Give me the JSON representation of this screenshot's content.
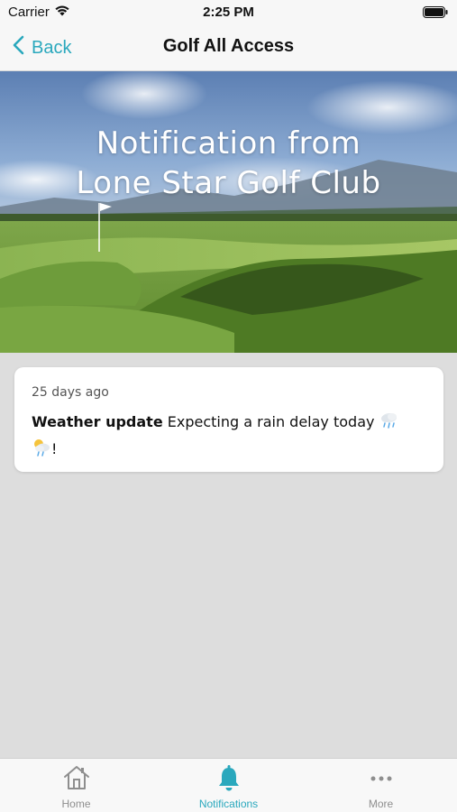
{
  "status_bar": {
    "carrier": "Carrier",
    "time": "2:25 PM"
  },
  "nav": {
    "back_label": "Back",
    "title": "Golf All Access"
  },
  "hero": {
    "title_line1": "Notification from",
    "title_line2": "Lone Star Golf Club"
  },
  "notification": {
    "time_ago": "25 days ago",
    "heading": "Weather update",
    "message": " Expecting a rain delay today ",
    "suffix": "!"
  },
  "tabs": [
    {
      "label": "Home",
      "icon": "home-icon",
      "active": false
    },
    {
      "label": "Notifications",
      "icon": "bell-icon",
      "active": true
    },
    {
      "label": "More",
      "icon": "more-icon",
      "active": false
    }
  ],
  "colors": {
    "accent": "#2aa8bd",
    "background": "#dddddd",
    "tab_inactive": "#8e8e8e"
  }
}
